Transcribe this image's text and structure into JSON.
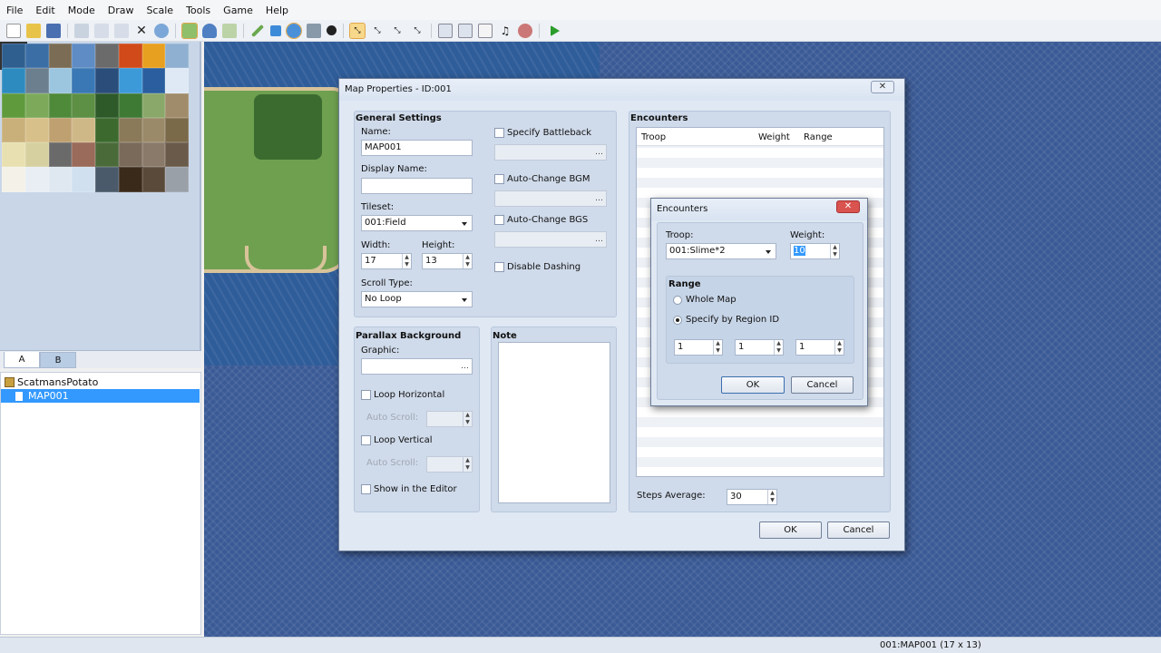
{
  "menu": [
    "File",
    "Edit",
    "Mode",
    "Draw",
    "Scale",
    "Tools",
    "Game",
    "Help"
  ],
  "tile_tabs": [
    "A",
    "B"
  ],
  "project_tree": {
    "root": "ScatmansPotato",
    "map": "MAP001"
  },
  "status": {
    "map_info": "001:MAP001 (17 x 13)"
  },
  "map_properties": {
    "title": "Map Properties - ID:001",
    "general": {
      "heading": "General Settings",
      "name_label": "Name:",
      "name_value": "MAP001",
      "display_name_label": "Display Name:",
      "display_name_value": "",
      "tileset_label": "Tileset:",
      "tileset_value": "001:Field",
      "width_label": "Width:",
      "width_value": "17",
      "height_label": "Height:",
      "height_value": "13",
      "scroll_label": "Scroll Type:",
      "scroll_value": "No Loop",
      "specify_battleback": "Specify Battleback",
      "autochange_bgm": "Auto-Change BGM",
      "autochange_bgs": "Auto-Change BGS",
      "disable_dashing": "Disable Dashing"
    },
    "parallax": {
      "heading": "Parallax Background",
      "graphic_label": "Graphic:",
      "loop_h": "Loop Horizontal",
      "loop_v": "Loop Vertical",
      "auto_scroll": "Auto Scroll:",
      "show_editor": "Show in the Editor"
    },
    "note": {
      "heading": "Note"
    },
    "encounters": {
      "heading": "Encounters",
      "columns": [
        "Troop",
        "Weight",
        "Range"
      ],
      "steps_label": "Steps Average:",
      "steps_value": "30"
    },
    "ok": "OK",
    "cancel": "Cancel"
  },
  "encounter_dialog": {
    "title": "Encounters",
    "troop_label": "Troop:",
    "troop_value": "001:Slime*2",
    "weight_label": "Weight:",
    "weight_value": "10",
    "range_heading": "Range",
    "whole_map": "Whole Map",
    "by_region": "Specify by Region ID",
    "regions": [
      "1",
      "1",
      "1"
    ],
    "ok": "OK",
    "cancel": "Cancel"
  },
  "colors": {
    "accent": "#3399ff",
    "map_bg": "#3a5a96"
  }
}
